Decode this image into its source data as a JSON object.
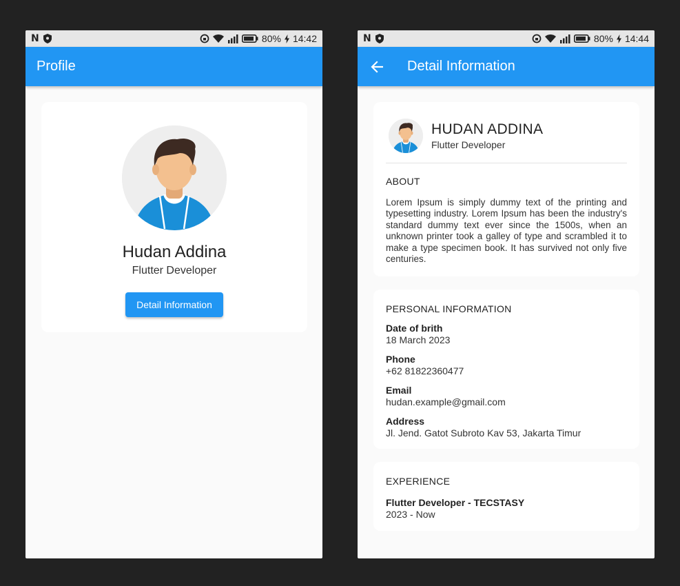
{
  "colors": {
    "background": "#222222",
    "app_bar": "#2196f3",
    "screen_bg": "#fafafa",
    "card": "#ffffff",
    "avatar_shirt": "#1a8fd8",
    "avatar_skin": "#f3c08f",
    "avatar_hair": "#3d2a22"
  },
  "left_screen": {
    "status_bar": {
      "battery": "80%",
      "time": "14:42"
    },
    "app_bar": {
      "title": "Profile"
    },
    "profile": {
      "name": "Hudan Addina",
      "role": "Flutter Developer",
      "button_label": "Detail Information"
    }
  },
  "right_screen": {
    "status_bar": {
      "battery": "80%",
      "time": "14:44"
    },
    "app_bar": {
      "title": "Detail Information",
      "back_icon": "arrow-back-icon"
    },
    "header": {
      "name": "HUDAN ADDINA",
      "role": "Flutter Developer"
    },
    "about": {
      "title": "ABOUT",
      "text": "Lorem Ipsum is simply dummy text of the printing and typesetting industry. Lorem Ipsum has been the industry's standard dummy text ever since the 1500s, when an unknown printer took a galley of type and scrambled it to make a type specimen book. It has survived not only five centuries."
    },
    "personal": {
      "title": "PERSONAL INFORMATION",
      "fields": [
        {
          "label": "Date of brith",
          "value": "18 March 2023"
        },
        {
          "label": "Phone",
          "value": "+62 81822360477"
        },
        {
          "label": "Email",
          "value": "hudan.example@gmail.com"
        },
        {
          "label": "Address",
          "value": "Jl. Jend. Gatot Subroto Kav 53, Jakarta Timur"
        }
      ]
    },
    "experience": {
      "title": "EXPERIENCE",
      "items": [
        {
          "title": "Flutter Developer - TECSTASY",
          "period": "2023 - Now"
        }
      ]
    }
  }
}
